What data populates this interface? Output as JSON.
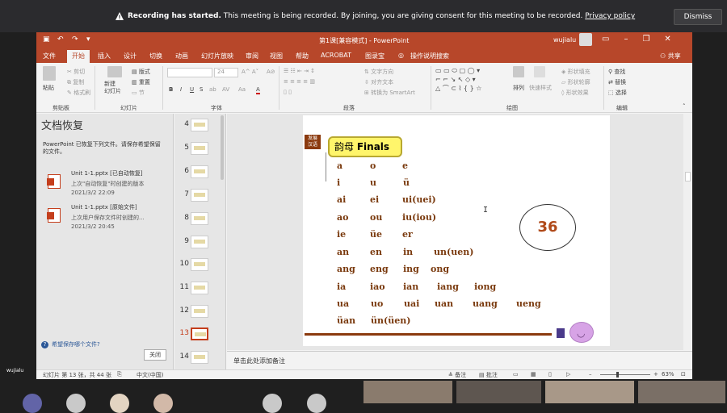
{
  "banner": {
    "bold": "Recording has started.",
    "text": " This meeting is being recorded. By joining, you are giving consent for this meeting to be recorded.",
    "link": "Privacy policy",
    "dismiss": "Dismiss"
  },
  "window": {
    "title": "第1课[兼容模式] - PowerPoint",
    "user": "wujialu"
  },
  "tabs": [
    "文件",
    "开始",
    "插入",
    "设计",
    "切换",
    "动画",
    "幻灯片放映",
    "审阅",
    "视图",
    "帮助",
    "ACROBAT",
    "图录宝",
    "操作说明搜索"
  ],
  "share": "共享",
  "ribbon": {
    "paste": "粘贴",
    "cut": "剪切",
    "copy": "复制",
    "format_painter": "格式刷",
    "new_slide": "新建\n幻灯片",
    "layout": "版式",
    "reset": "重置",
    "section": "节",
    "font_size": "24",
    "text_direction": "文字方向",
    "align_text": "对齐文本",
    "smartart": "转换为 SmartArt",
    "arrange": "排列",
    "quick_styles": "快速样式",
    "shape_fill": "形状填充",
    "shape_outline": "形状轮廓",
    "shape_effects": "形状效果",
    "find": "查找",
    "replace": "替换",
    "select": "选择",
    "groups": [
      "剪贴板",
      "幻灯片",
      "字体",
      "段落",
      "绘图",
      "编辑"
    ],
    "font_btns": [
      "B",
      "I",
      "U",
      "S",
      "ab",
      "AV",
      "Aa",
      "A"
    ]
  },
  "recovery": {
    "title": "文档恢复",
    "desc": "PowerPoint 已恢复下列文件。请保存希望保留的文件。",
    "files": [
      {
        "name": "Unit 1-1.pptx  [已自动恢复]",
        "sub": "上次\"自动恢复\"时创建的版本",
        "time": "2021/3/2 22:09"
      },
      {
        "name": "Unit 1-1.pptx  [原始文件]",
        "sub": "上次用户保存文件时创建的...",
        "time": "2021/3/2 20:45"
      }
    ],
    "help": "希望保存哪个文件?",
    "close": "关闭"
  },
  "thumbs": [
    "4",
    "5",
    "6",
    "7",
    "8",
    "9",
    "10",
    "11",
    "12",
    "13",
    "14"
  ],
  "active_slide": "13",
  "slide": {
    "badge": "发展\n汉语",
    "title_cn": "韵母",
    "title_en": "Finals",
    "rows": [
      [
        "a",
        "o",
        "e"
      ],
      [
        "i",
        "u",
        "ü"
      ],
      [
        "ai",
        "ei",
        "ui(uei)"
      ],
      [
        "ao",
        "ou",
        "iu(iou)"
      ],
      [
        "ie",
        "üe",
        "er"
      ],
      [
        "an",
        "en",
        "in",
        "un(uen)"
      ],
      [
        "ang",
        "eng",
        "ing",
        "ong"
      ],
      [
        "ia",
        "iao",
        "ian",
        "iang",
        "iong"
      ],
      [
        "ua",
        "uo",
        "uai",
        "uan",
        "uang",
        "ueng"
      ],
      [
        "üan",
        "ün(üen)"
      ]
    ],
    "page_number": "36"
  },
  "notes": "单击此处添加备注",
  "status": {
    "slide_count": "幻灯片 第 13 张，共 44 张",
    "language": "中文(中国)",
    "notes_btn": "备注",
    "comments_btn": "批注",
    "zoom": "63%"
  },
  "participant": "wujialu"
}
